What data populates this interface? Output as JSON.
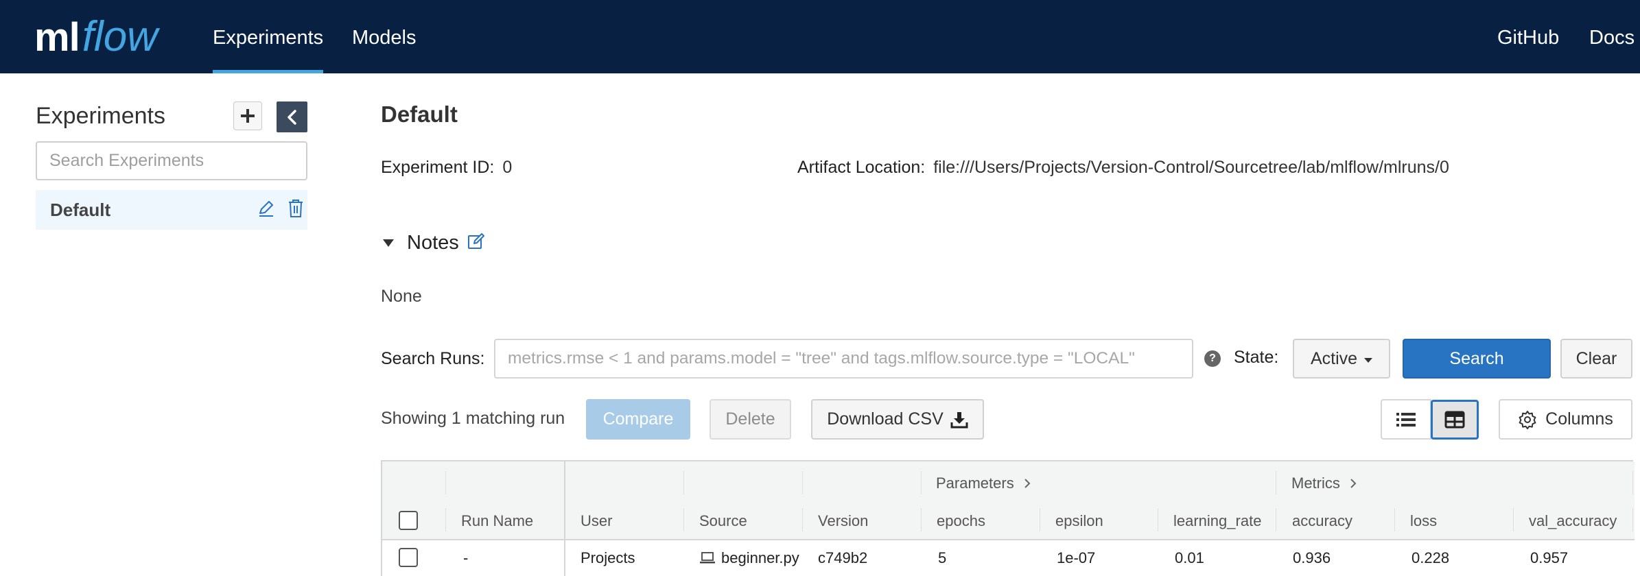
{
  "brand": {
    "ml": "ml",
    "flow": "flow"
  },
  "topnav": {
    "items": [
      {
        "label": "Experiments",
        "active": true
      },
      {
        "label": "Models",
        "active": false
      }
    ],
    "right": [
      {
        "label": "GitHub"
      },
      {
        "label": "Docs"
      }
    ]
  },
  "sidebar": {
    "title": "Experiments",
    "add_icon": "plus-icon",
    "collapse_icon": "chevron-left-icon",
    "search_placeholder": "Search Experiments",
    "items": [
      {
        "label": "Default",
        "selected": true
      }
    ]
  },
  "experiment": {
    "title": "Default",
    "id_label": "Experiment ID:",
    "id_value": "0",
    "artifact_label": "Artifact Location:",
    "artifact_value": "file:///Users/Projects/Version-Control/Sourcetree/lab/mlflow/mlruns/0",
    "notes_label": "Notes",
    "notes_value": "None"
  },
  "search": {
    "label": "Search Runs:",
    "placeholder": "metrics.rmse < 1 and params.model = \"tree\" and tags.mlflow.source.type = \"LOCAL\"",
    "help": "?",
    "state_label": "State:",
    "state_value": "Active",
    "search_button": "Search",
    "clear_button": "Clear"
  },
  "toolbar": {
    "showing": "Showing 1 matching run",
    "compare": "Compare",
    "delete": "Delete",
    "download": "Download CSV",
    "columns": "Columns"
  },
  "table": {
    "groups": {
      "parameters": "Parameters",
      "metrics": "Metrics"
    },
    "headers": {
      "run_name": "Run Name",
      "user": "User",
      "source": "Source",
      "version": "Version",
      "epochs": "epochs",
      "epsilon": "epsilon",
      "learning_rate": "learning_rate",
      "accuracy": "accuracy",
      "loss": "loss",
      "val_accuracy": "val_accuracy"
    },
    "rows": [
      {
        "run_name": "-",
        "user": "Projects",
        "source": "beginner.py",
        "version": "c749b2",
        "epochs": "5",
        "epsilon": "1e-07",
        "learning_rate": "0.01",
        "accuracy": "0.936",
        "loss": "0.228",
        "val_accuracy": "0.957"
      }
    ]
  },
  "colors": {
    "nav_bg": "#082142",
    "accent": "#43a6e3",
    "primary": "#2874c2",
    "sidebar_selected": "#eef7fd"
  }
}
